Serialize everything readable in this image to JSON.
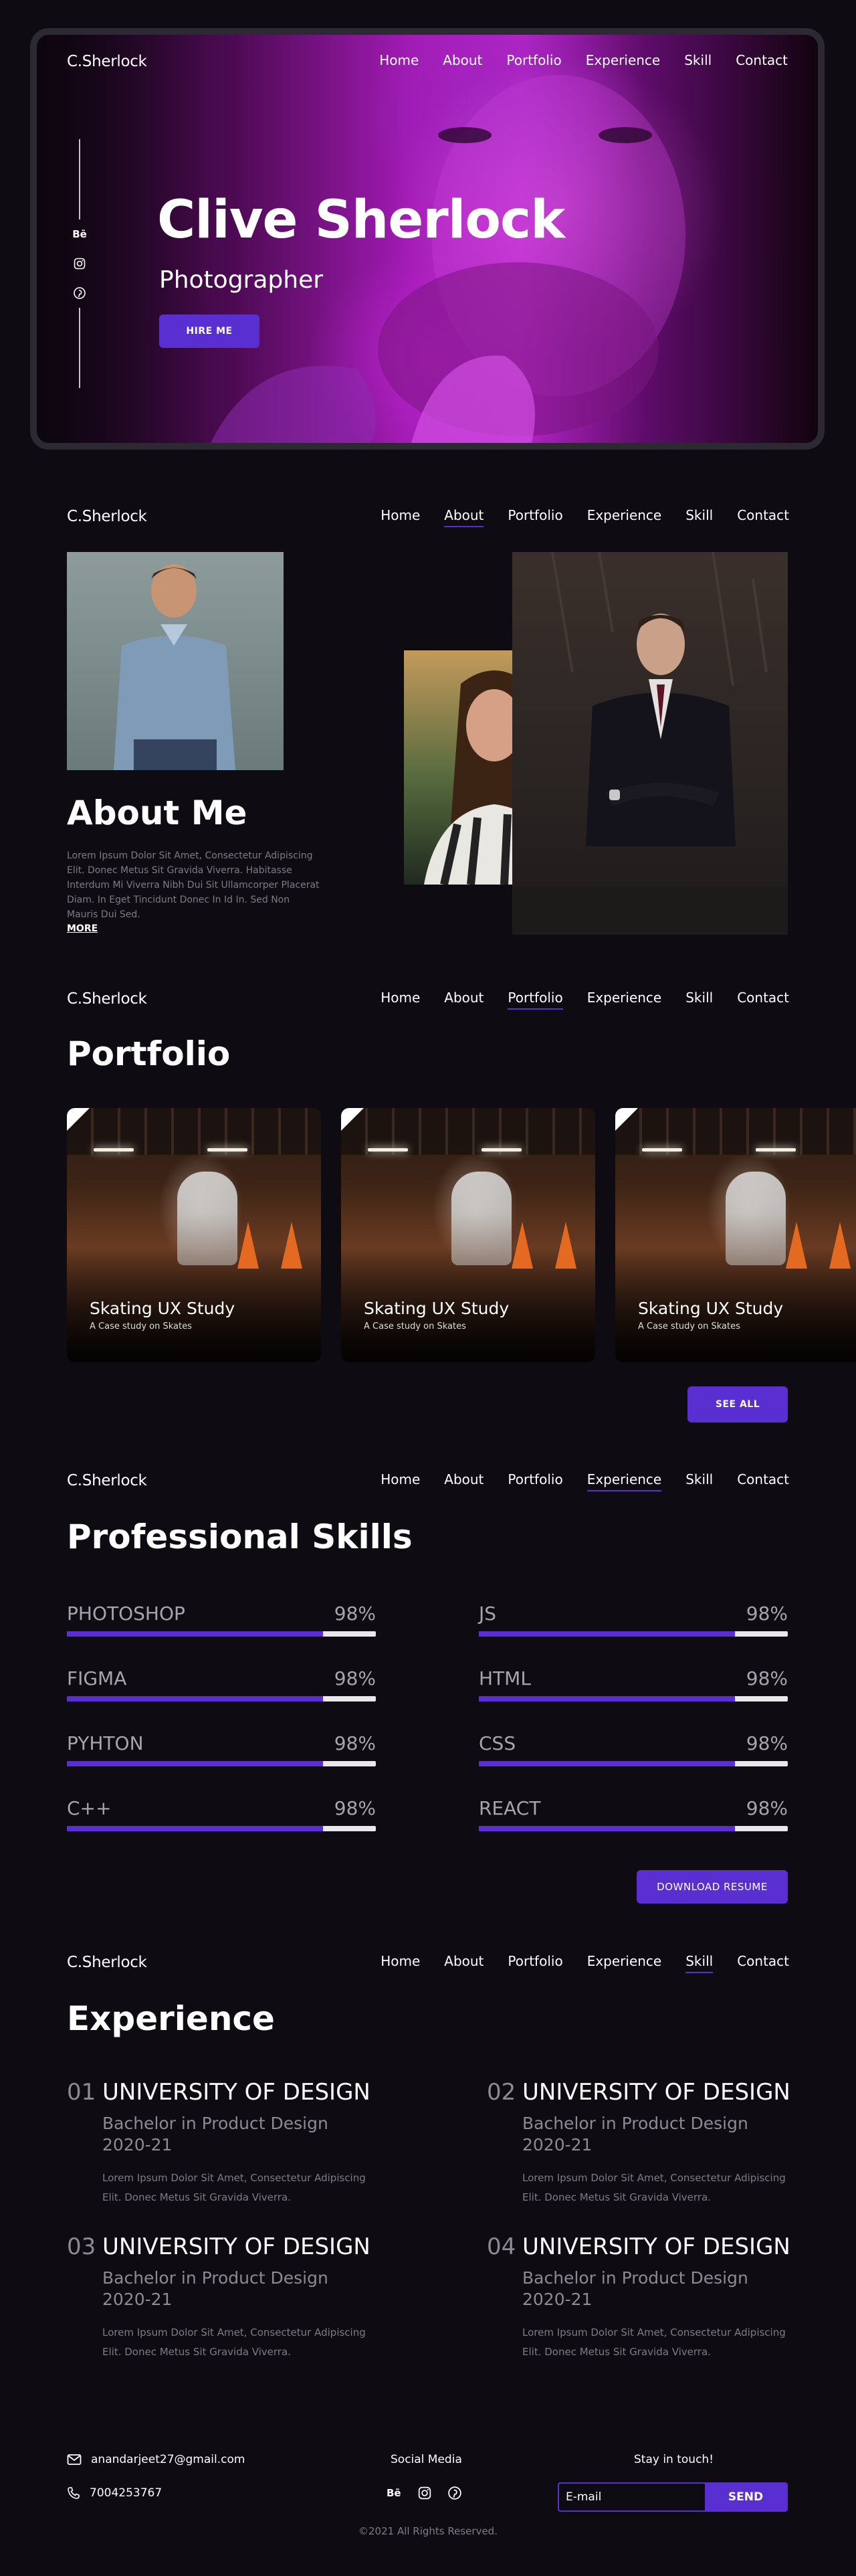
{
  "nav": {
    "logo": "C.Sherlock",
    "links": [
      "Home",
      "About",
      "Portfolio",
      "Experience",
      "Skill",
      "Contact"
    ]
  },
  "hero": {
    "name": "Clive Sherlock",
    "role": "Photographer",
    "cta": "HIRE ME",
    "social": [
      "behance-icon",
      "instagram-icon",
      "pinterest-icon"
    ],
    "behance_glyph": "Bē",
    "accent": "#5a2fd1"
  },
  "about": {
    "title": "About Me",
    "text": "Lorem Ipsum Dolor Sit Amet, Consectetur Adipiscing Elit. Donec Metus Sit Gravida Viverra. Habitasse Interdum Mi Viverra Nibh Dui Sit Ullamcorper Placerat Diam. In Eget Tincidunt Donec In Id In. Sed Non Mauris Dui Sed.",
    "more": "MORE"
  },
  "portfolio": {
    "title": "Portfolio",
    "cards": [
      {
        "title": "Skating UX Study",
        "subtitle": "A Case study on Skates"
      },
      {
        "title": "Skating UX Study",
        "subtitle": "A Case study on Skates"
      },
      {
        "title": "Skating UX Study",
        "subtitle": "A Case study on Skates"
      }
    ],
    "see_all": "SEE ALL"
  },
  "skills": {
    "title": "Professional Skills",
    "items": [
      {
        "name": "PHOTOSHOP",
        "value": "98%",
        "fill": 0.83
      },
      {
        "name": "JS",
        "value": "98%",
        "fill": 0.83
      },
      {
        "name": "FIGMA",
        "value": "98%",
        "fill": 0.83
      },
      {
        "name": "HTML",
        "value": "98%",
        "fill": 0.83
      },
      {
        "name": "PYHTON",
        "value": "98%",
        "fill": 0.83
      },
      {
        "name": "CSS",
        "value": "98%",
        "fill": 0.83
      },
      {
        "name": "C++",
        "value": "98%",
        "fill": 0.83
      },
      {
        "name": "REACT",
        "value": "98%",
        "fill": 0.83
      }
    ],
    "download": "DOWNLOAD RESUME"
  },
  "experience": {
    "title": "Experience",
    "items": [
      {
        "num": "01",
        "school": "UNIVERSITY OF DESIGN",
        "degree": "Bachelor in Product Design",
        "year": "2020-21",
        "desc": "Lorem Ipsum Dolor Sit Amet, Consectetur Adipiscing Elit. Donec Metus Sit Gravida Viverra."
      },
      {
        "num": "02",
        "school": "UNIVERSITY OF DESIGN",
        "degree": "Bachelor in Product Design",
        "year": "2020-21",
        "desc": "Lorem Ipsum Dolor Sit Amet, Consectetur Adipiscing Elit. Donec Metus Sit Gravida Viverra."
      },
      {
        "num": "03",
        "school": "UNIVERSITY OF DESIGN",
        "degree": "Bachelor in Product Design",
        "year": "2020-21",
        "desc": "Lorem Ipsum Dolor Sit Amet, Consectetur Adipiscing Elit. Donec Metus Sit Gravida Viverra."
      },
      {
        "num": "04",
        "school": "UNIVERSITY OF DESIGN",
        "degree": "Bachelor in Product Design",
        "year": "2020-21",
        "desc": "Lorem Ipsum Dolor Sit Amet, Consectetur Adipiscing Elit. Donec Metus Sit Gravida Viverra."
      }
    ]
  },
  "footer": {
    "email": "anandarjeet27@gmail.com",
    "phone": "7004253767",
    "social_heading": "Social Media",
    "newsletter_heading": "Stay in touch!",
    "email_placeholder": "E-mail",
    "send": "SEND",
    "copyright": "©2021 All Rights Reserved."
  }
}
